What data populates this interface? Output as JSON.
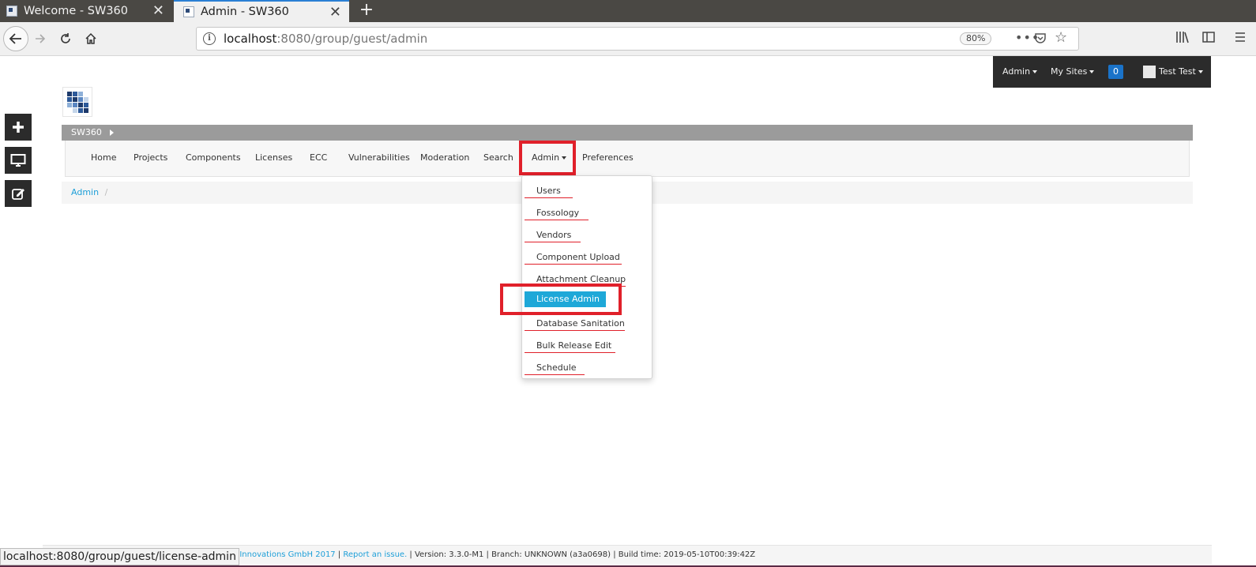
{
  "browser": {
    "tabs": [
      {
        "title": "Welcome - SW360",
        "active": false
      },
      {
        "title": "Admin - SW360",
        "active": true
      }
    ],
    "new_tab_label": "+",
    "close_glyph": "✕",
    "url_host": "localhost",
    "url_rest": ":8080/group/guest/admin",
    "zoom": "80%",
    "more_glyph": "•••",
    "star_glyph": "☆",
    "info_glyph": "i"
  },
  "userbar": {
    "admin_label": "Admin",
    "sites_label": "My Sites",
    "notification_count": "0",
    "user_label": "Test Test"
  },
  "site": {
    "name": "SW360"
  },
  "nav": {
    "items": [
      {
        "label": "Home"
      },
      {
        "label": "Projects"
      },
      {
        "label": "Components"
      },
      {
        "label": "Licenses"
      },
      {
        "label": "ECC"
      },
      {
        "label": "Vulnerabilities"
      },
      {
        "label": "Moderation"
      },
      {
        "label": "Search"
      },
      {
        "label": "Admin"
      },
      {
        "label": "Preferences"
      }
    ]
  },
  "breadcrumb": {
    "items": [
      {
        "label": "Admin"
      }
    ],
    "separator": "/"
  },
  "admin_menu": {
    "items": [
      {
        "label": "Users"
      },
      {
        "label": "Fossology"
      },
      {
        "label": "Vendors"
      },
      {
        "label": "Component Upload"
      },
      {
        "label": "Attachment Cleanup"
      },
      {
        "label": "License Admin",
        "highlighted": true
      },
      {
        "label": "Database Sanitation"
      },
      {
        "label": "Bulk Release Edit"
      },
      {
        "label": "Schedule"
      }
    ]
  },
  "footer": {
    "text_prefix": "are Innovations GmbH 2017",
    "sep1": " | ",
    "report_link": "Report an issue.",
    "version_info": " | Version: 3.3.0-M1 | Branch: UNKNOWN (a3a0698) | Build time: 2019-05-10T00:39:42Z"
  },
  "status_url": "localhost:8080/group/guest/license-admin",
  "colors": {
    "accent": "#1ea8d8",
    "highlight_box": "#e0202a",
    "dark_bar": "#2b2b2b",
    "notification": "#1a73c9"
  }
}
